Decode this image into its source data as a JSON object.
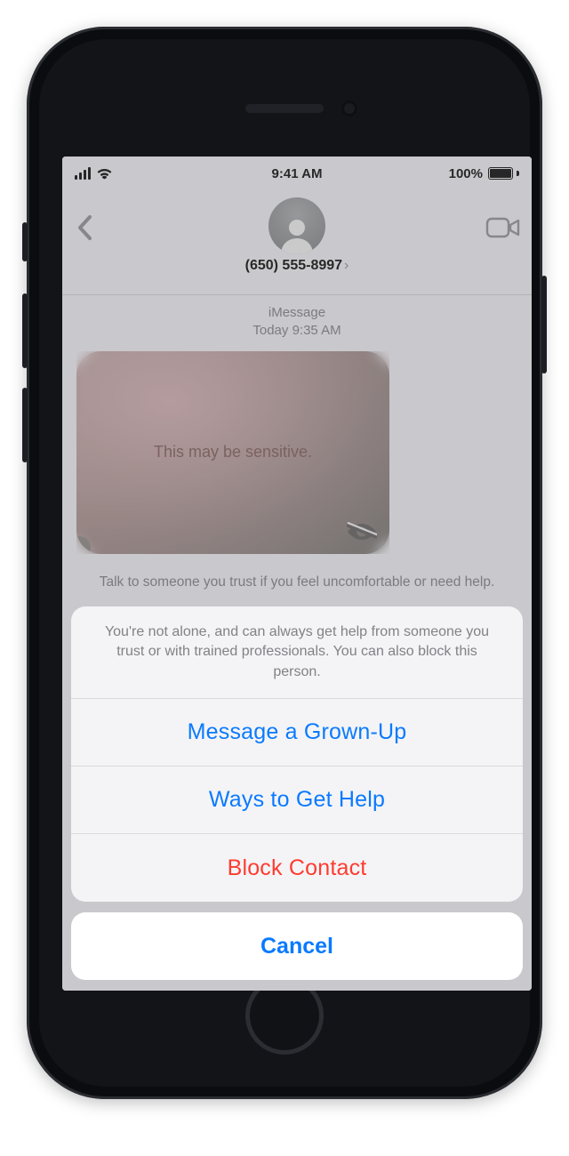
{
  "status": {
    "time": "9:41 AM",
    "battery_pct": "100%"
  },
  "nav": {
    "contact_number": "(650) 555-8997"
  },
  "thread": {
    "service": "iMessage",
    "timestamp_day": "Today",
    "timestamp_time": "9:35 AM",
    "sensitive_label": "This may be sensitive.",
    "help_text": "Talk to someone you trust if you feel uncomfortable or need help."
  },
  "sheet": {
    "message": "You're not alone, and can always get help from someone you trust or with trained professionals. You can also block this person.",
    "actions": {
      "message_grownup": "Message a Grown-Up",
      "ways_help": "Ways to Get Help",
      "block": "Block Contact"
    },
    "cancel": "Cancel"
  }
}
